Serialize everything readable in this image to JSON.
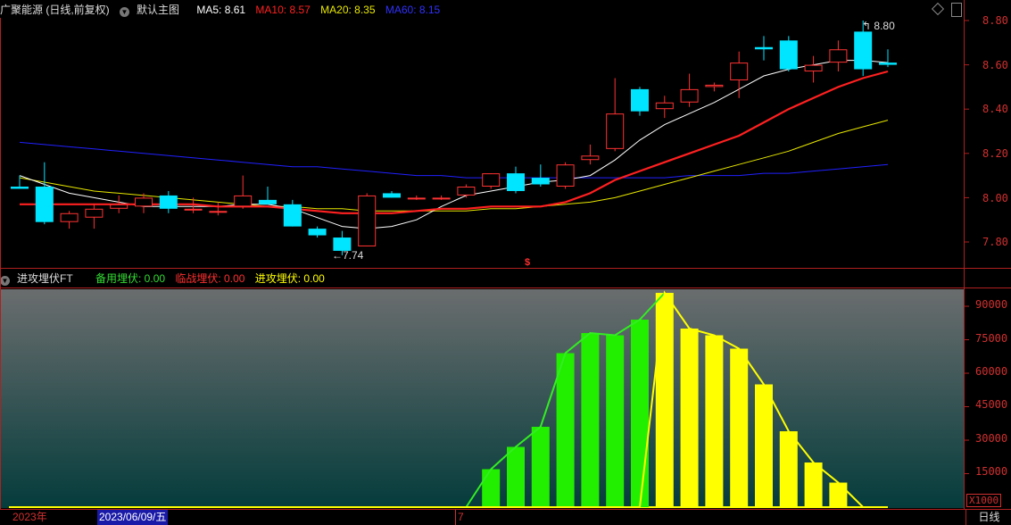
{
  "header": {
    "stock_name": "广聚能源 (日线,前复权)",
    "main_chart_name": "默认主图",
    "ma5": "MA5: 8.61",
    "ma10": "MA10: 8.57",
    "ma20": "MA20: 8.35",
    "ma60": "MA60: 8.15",
    "ma5_color": "#ffffff",
    "ma10_color": "#ff2020",
    "ma20_color": "#e8e800",
    "ma60_color": "#2020ff"
  },
  "sub_header": {
    "indicator_name": "进攻埋伏FT",
    "spare": "备用埋伏: 0.00",
    "critical": "临战埋伏: 0.00",
    "attack": "进攻埋伏: 0.00",
    "spare_color": "#33dd33",
    "critical_color": "#ff3030",
    "attack_color": "#ffff00"
  },
  "annotations": {
    "high_label": "8.80",
    "low_label": "7.74",
    "marker": "$"
  },
  "price_axis": [
    "8.80",
    "8.60",
    "8.40",
    "8.20",
    "8.00",
    "7.80"
  ],
  "volume_axis": [
    "90000",
    "75000",
    "60000",
    "45000",
    "30000",
    "15000"
  ],
  "volume_unit": "X1000",
  "date_bar": {
    "year": "2023年",
    "selected_date": "2023/06/09/五",
    "month_mark": "7",
    "period": "日线"
  },
  "chart_data": [
    {
      "type": "candlestick",
      "ylim": [
        7.68,
        8.88
      ],
      "candles": [
        {
          "o": 8.05,
          "h": 8.1,
          "l": 8.04,
          "c": 8.04
        },
        {
          "o": 8.05,
          "h": 8.16,
          "l": 7.88,
          "c": 7.89
        },
        {
          "o": 7.89,
          "h": 7.94,
          "l": 7.86,
          "c": 7.93
        },
        {
          "o": 7.91,
          "h": 7.97,
          "l": 7.86,
          "c": 7.95
        },
        {
          "o": 7.95,
          "h": 8.01,
          "l": 7.93,
          "c": 7.97
        },
        {
          "o": 7.96,
          "h": 8.02,
          "l": 7.93,
          "c": 8.0
        },
        {
          "o": 8.01,
          "h": 8.03,
          "l": 7.93,
          "c": 7.95
        },
        {
          "o": 7.95,
          "h": 8.0,
          "l": 7.93,
          "c": 7.95
        },
        {
          "o": 7.94,
          "h": 7.98,
          "l": 7.92,
          "c": 7.94
        },
        {
          "o": 7.96,
          "h": 8.1,
          "l": 7.95,
          "c": 8.01
        },
        {
          "o": 7.99,
          "h": 8.05,
          "l": 7.97,
          "c": 7.97
        },
        {
          "o": 7.97,
          "h": 7.99,
          "l": 7.87,
          "c": 7.87
        },
        {
          "o": 7.86,
          "h": 7.87,
          "l": 7.82,
          "c": 7.83
        },
        {
          "o": 7.82,
          "h": 7.85,
          "l": 7.74,
          "c": 7.76
        },
        {
          "o": 7.78,
          "h": 8.02,
          "l": 7.78,
          "c": 8.01
        },
        {
          "o": 8.02,
          "h": 8.03,
          "l": 8.0,
          "c": 8.0
        },
        {
          "o": 8.0,
          "h": 8.01,
          "l": 7.99,
          "c": 8.0
        },
        {
          "o": 8.0,
          "h": 8.01,
          "l": 7.99,
          "c": 8.0
        },
        {
          "o": 8.01,
          "h": 8.06,
          "l": 8.0,
          "c": 8.05
        },
        {
          "o": 8.05,
          "h": 8.11,
          "l": 8.04,
          "c": 8.11
        },
        {
          "o": 8.11,
          "h": 8.14,
          "l": 8.02,
          "c": 8.03
        },
        {
          "o": 8.09,
          "h": 8.15,
          "l": 8.05,
          "c": 8.06
        },
        {
          "o": 8.05,
          "h": 8.16,
          "l": 8.04,
          "c": 8.15
        },
        {
          "o": 8.17,
          "h": 8.24,
          "l": 8.15,
          "c": 8.19
        },
        {
          "o": 8.22,
          "h": 8.54,
          "l": 8.21,
          "c": 8.38
        },
        {
          "o": 8.49,
          "h": 8.5,
          "l": 8.37,
          "c": 8.39
        },
        {
          "o": 8.4,
          "h": 8.46,
          "l": 8.36,
          "c": 8.43
        },
        {
          "o": 8.43,
          "h": 8.56,
          "l": 8.41,
          "c": 8.49
        },
        {
          "o": 8.5,
          "h": 8.52,
          "l": 8.48,
          "c": 8.51
        },
        {
          "o": 8.53,
          "h": 8.66,
          "l": 8.45,
          "c": 8.61
        },
        {
          "o": 8.68,
          "h": 8.73,
          "l": 8.62,
          "c": 8.67
        },
        {
          "o": 8.71,
          "h": 8.73,
          "l": 8.57,
          "c": 8.58
        },
        {
          "o": 8.57,
          "h": 8.64,
          "l": 8.52,
          "c": 8.6
        },
        {
          "o": 8.61,
          "h": 8.71,
          "l": 8.57,
          "c": 8.67
        },
        {
          "o": 8.75,
          "h": 8.8,
          "l": 8.55,
          "c": 8.58
        },
        {
          "o": 8.61,
          "h": 8.67,
          "l": 8.59,
          "c": 8.6
        }
      ],
      "ma_series": [
        {
          "name": "MA5",
          "color": "#ffffff",
          "values": [
            8.1,
            8.06,
            8.02,
            8.0,
            7.98,
            7.96,
            7.96,
            7.96,
            7.96,
            7.97,
            7.97,
            7.95,
            7.91,
            7.87,
            7.86,
            7.87,
            7.9,
            7.96,
            8.01,
            8.03,
            8.05,
            8.07,
            8.08,
            8.1,
            8.17,
            8.26,
            8.33,
            8.38,
            8.43,
            8.49,
            8.55,
            8.58,
            8.6,
            8.62,
            8.62,
            8.61
          ]
        },
        {
          "name": "MA10",
          "color": "#ff2020",
          "values": [
            7.97,
            7.97,
            7.97,
            7.97,
            7.97,
            7.97,
            7.97,
            7.97,
            7.96,
            7.96,
            7.96,
            7.95,
            7.94,
            7.93,
            7.93,
            7.93,
            7.94,
            7.95,
            7.95,
            7.96,
            7.96,
            7.96,
            7.98,
            8.02,
            8.08,
            8.12,
            8.16,
            8.2,
            8.24,
            8.28,
            8.34,
            8.4,
            8.45,
            8.5,
            8.54,
            8.57
          ]
        },
        {
          "name": "MA20",
          "color": "#e8e800",
          "values": [
            8.09,
            8.07,
            8.05,
            8.03,
            8.02,
            8.01,
            8.0,
            7.99,
            7.98,
            7.97,
            7.96,
            7.96,
            7.95,
            7.95,
            7.94,
            7.94,
            7.94,
            7.94,
            7.94,
            7.95,
            7.95,
            7.96,
            7.97,
            7.98,
            8.0,
            8.03,
            8.06,
            8.09,
            8.12,
            8.15,
            8.18,
            8.21,
            8.25,
            8.29,
            8.32,
            8.35
          ]
        },
        {
          "name": "MA60",
          "color": "#2020ff",
          "values": [
            8.25,
            8.24,
            8.23,
            8.22,
            8.21,
            8.2,
            8.19,
            8.18,
            8.17,
            8.16,
            8.15,
            8.14,
            8.14,
            8.13,
            8.12,
            8.11,
            8.1,
            8.1,
            8.09,
            8.09,
            8.09,
            8.09,
            8.09,
            8.09,
            8.09,
            8.09,
            8.09,
            8.1,
            8.1,
            8.1,
            8.11,
            8.11,
            8.12,
            8.13,
            8.14,
            8.15
          ]
        }
      ]
    },
    {
      "type": "bar",
      "ylim": [
        0,
        96000
      ],
      "bars": [
        {
          "i": 19,
          "value": 17000,
          "color": "#22ee00"
        },
        {
          "i": 20,
          "value": 27000,
          "color": "#22ee00"
        },
        {
          "i": 21,
          "value": 36000,
          "color": "#22ee00"
        },
        {
          "i": 22,
          "value": 69000,
          "color": "#22ee00"
        },
        {
          "i": 23,
          "value": 78000,
          "color": "#22ee00"
        },
        {
          "i": 24,
          "value": 77000,
          "color": "#22ee00"
        },
        {
          "i": 25,
          "value": 84000,
          "color": "#22ee00"
        },
        {
          "i": 26,
          "value": 96000,
          "color": "#ffff00"
        },
        {
          "i": 27,
          "value": 80000,
          "color": "#ffff00"
        },
        {
          "i": 28,
          "value": 77000,
          "color": "#ffff00"
        },
        {
          "i": 29,
          "value": 71000,
          "color": "#ffff00"
        },
        {
          "i": 30,
          "value": 55000,
          "color": "#ffff00"
        },
        {
          "i": 31,
          "value": 34000,
          "color": "#ffff00"
        },
        {
          "i": 32,
          "value": 20000,
          "color": "#ffff00"
        },
        {
          "i": 33,
          "value": 11000,
          "color": "#ffff00"
        }
      ],
      "green_line": [
        [
          18,
          0
        ],
        [
          19,
          17000
        ],
        [
          20,
          27000
        ],
        [
          21,
          36000
        ],
        [
          22,
          69000
        ],
        [
          23,
          78000
        ],
        [
          24,
          77000
        ],
        [
          25,
          84000
        ],
        [
          26,
          96000
        ]
      ],
      "yellow_line": [
        [
          0,
          0
        ],
        [
          25,
          0
        ],
        [
          26,
          96000
        ],
        [
          27,
          80000
        ],
        [
          28,
          77000
        ],
        [
          29,
          71000
        ],
        [
          30,
          55000
        ],
        [
          31,
          34000
        ],
        [
          32,
          20000
        ],
        [
          33,
          11000
        ],
        [
          34,
          0
        ],
        [
          35,
          0
        ]
      ]
    }
  ]
}
